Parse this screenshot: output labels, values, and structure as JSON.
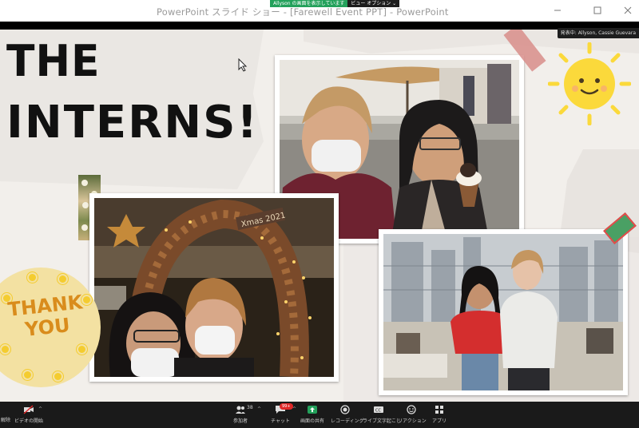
{
  "window": {
    "title": "PowerPoint スライド ショー - [Farewell Event PPT] - PowerPoint",
    "share_banner": "Allyson の画面を表示しています",
    "view_options": "ビュー オプション ⌄",
    "presenter_tag": "発表中: Allyson, Cassie Guevara"
  },
  "slide": {
    "title_line1": "THE",
    "title_line2": "INTERNS!",
    "thank_you_line1": "THANK",
    "thank_you_line2": "YOU",
    "photo_sign": "Xmas 2021"
  },
  "toolbar": {
    "mute_label": "解除",
    "video_label": "ビデオの開始",
    "participants_label": "参加者",
    "participants_count": "38",
    "chat_label": "チャット",
    "chat_badge": "99+",
    "share_label": "画面の共有",
    "record_label": "レコーディング",
    "captions_label": "ライブ文字起こし",
    "reactions_label": "リアクション",
    "apps_label": "アプリ"
  },
  "colors": {
    "slide_bg": "#f2efeb",
    "sun": "#fbd93b",
    "thank_you_text": "#d98c1c",
    "share_green": "#23a15b",
    "toolbar_bg": "#1a1a1a"
  }
}
